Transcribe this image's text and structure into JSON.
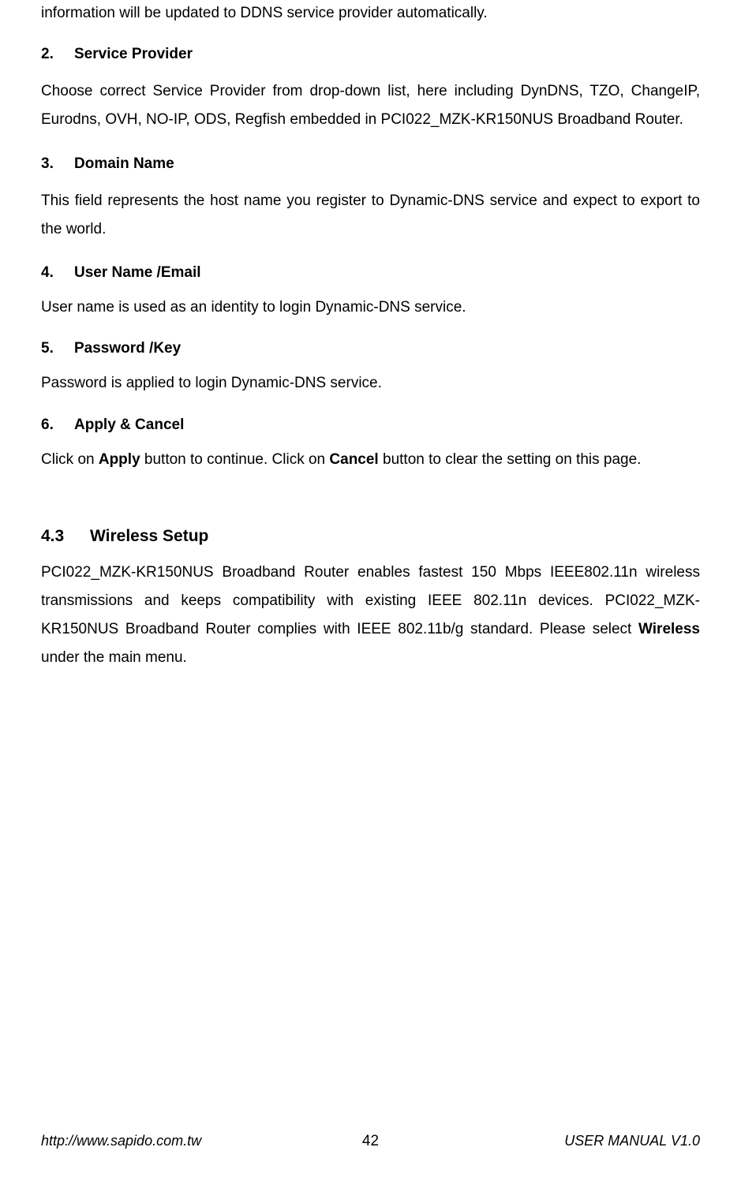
{
  "intro_line": "information will be updated to DDNS service provider automatically.",
  "sections": {
    "s2": {
      "num": "2.",
      "title": "Service Provider",
      "body": "Choose correct Service Provider from drop-down list, here including DynDNS, TZO, ChangeIP, Eurodns, OVH, NO-IP, ODS, Regfish embedded in PCI022_MZK-KR150NUS Broadband Router."
    },
    "s3": {
      "num": "3.",
      "title": "Domain Name",
      "body": "This field represents the host name you register to Dynamic-DNS service and expect to export to the world."
    },
    "s4": {
      "num": "4.",
      "title": "User Name /Email",
      "body": "User name is used as an identity to login Dynamic-DNS service."
    },
    "s5": {
      "num": "5.",
      "title": "Password /Key",
      "body": "Password is applied to login Dynamic-DNS service."
    },
    "s6": {
      "num": "6.",
      "title": "Apply & Cancel",
      "body_pre": "Click on ",
      "body_bold1": "Apply",
      "body_mid": " button to continue. Click on ",
      "body_bold2": "Cancel",
      "body_post": " button to clear the setting on this page."
    }
  },
  "chapter": {
    "num": "4.3",
    "title": "Wireless Setup",
    "body_pre": "PCI022_MZK-KR150NUS Broadband Router enables fastest 150 Mbps IEEE802.11n wireless transmissions and keeps compatibility with existing IEEE 802.11n devices. PCI022_MZK-KR150NUS Broadband Router complies with IEEE 802.11b/g standard. Please select ",
    "body_bold": "Wireless",
    "body_post": " under the main menu."
  },
  "footer": {
    "left": "http://www.sapido.com.tw",
    "center": "42",
    "right": "USER MANUAL V1.0"
  }
}
